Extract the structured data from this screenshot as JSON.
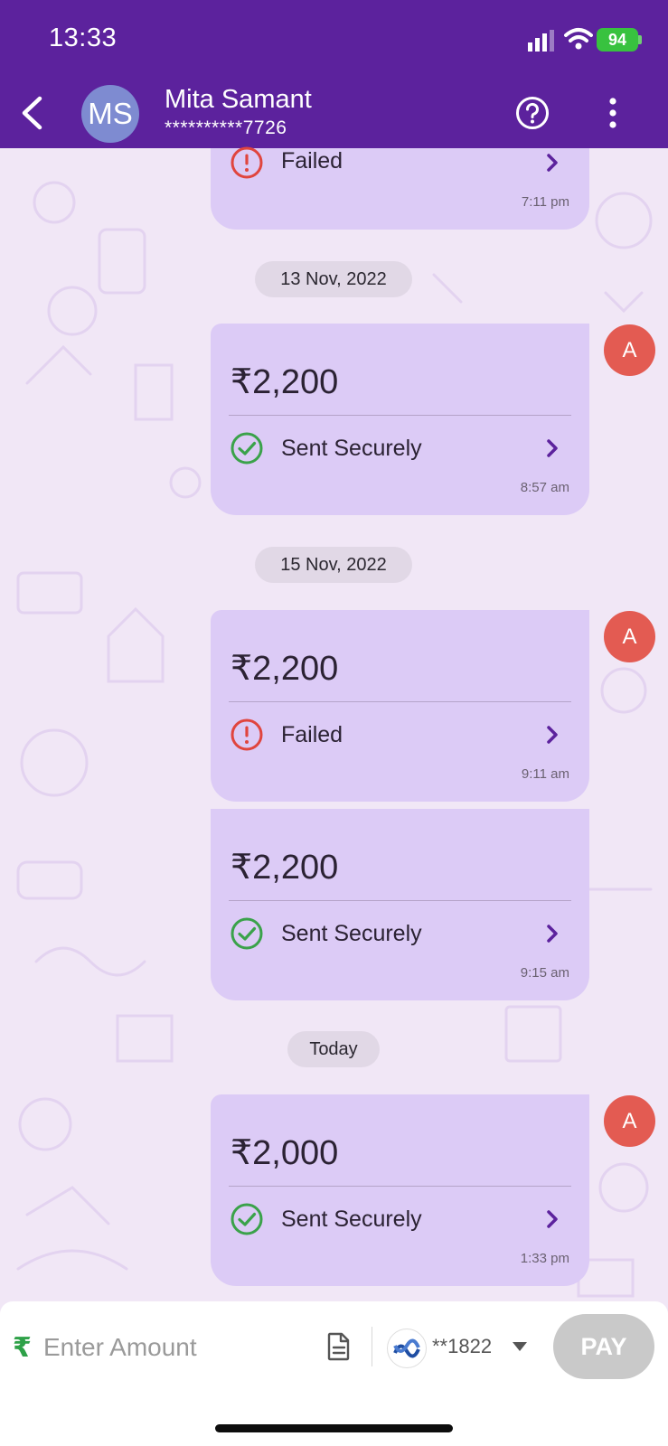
{
  "status_bar": {
    "time": "13:33",
    "battery": "94"
  },
  "header": {
    "avatar_initials": "MS",
    "contact_name": "Mita Samant",
    "contact_number": "**********7726"
  },
  "chat": {
    "top_partial": {
      "status": "Failed",
      "time": "7:11 pm"
    },
    "date_1": "13 Nov, 2022",
    "date_2": "15 Nov, 2022",
    "date_3": "Today",
    "sender_initial": "A",
    "transactions": [
      {
        "amount": "₹2,200",
        "status": "Sent Securely",
        "time": "8:57 am"
      },
      {
        "amount": "₹2,200",
        "status": "Failed",
        "time": "9:11 am"
      },
      {
        "amount": "₹2,200",
        "status": "Sent Securely",
        "time": "9:15 am"
      },
      {
        "amount": "₹2,000",
        "status": "Sent Securely",
        "time": "1:33 pm"
      }
    ]
  },
  "footer": {
    "currency_symbol": "₹",
    "amount_placeholder": "Enter Amount",
    "bank_account": "**1822",
    "pay_label": "PAY"
  },
  "colors": {
    "header_bg": "#5c229d",
    "bubble_bg": "#dccbf6",
    "success": "#3aa24a",
    "failure": "#e0453e",
    "accent": "#5c229d"
  }
}
